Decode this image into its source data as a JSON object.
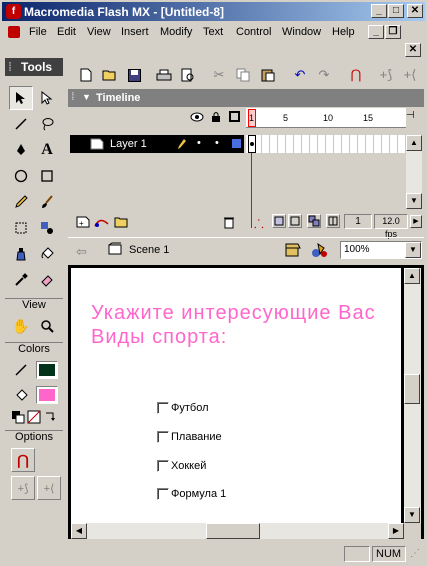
{
  "window": {
    "title": "Macromedia Flash MX - [Untitled-8]",
    "buttons": {
      "minimize": "_",
      "maximize": "□",
      "close": "✕"
    }
  },
  "menu": {
    "items": [
      "File",
      "Edit",
      "View",
      "Insert",
      "Modify",
      "Text",
      "Control",
      "Window",
      "Help"
    ],
    "doc_buttons": {
      "minimize": "_",
      "restore": "❐",
      "close": "✕"
    }
  },
  "tools": {
    "title": "Tools",
    "sections": {
      "view": "View",
      "colors": "Colors",
      "options": "Options"
    },
    "stroke_color": "#00331a",
    "fill_color": "#ff66cc"
  },
  "timeline": {
    "title": "Timeline",
    "layer": {
      "name": "Layer 1"
    },
    "frame_ticks": [
      "1",
      "5",
      "10",
      "15"
    ],
    "current_frame": "1",
    "frame_rate": "12.0 fps"
  },
  "scene": {
    "name": "Scene 1",
    "zoom": "100%"
  },
  "stage": {
    "heading_line1": "Укажите интересующие Вас",
    "heading_line2": "Виды спорта:",
    "options": [
      "Футбол",
      "Плавание",
      "Хоккей",
      "Формула 1"
    ]
  },
  "status": {
    "num": "NUM"
  },
  "colors": {
    "titlebar_start": "#0a246a",
    "titlebar_end": "#a6caf0",
    "heading_pink": "#ff66cc",
    "playhead_red": "#ff0000"
  }
}
